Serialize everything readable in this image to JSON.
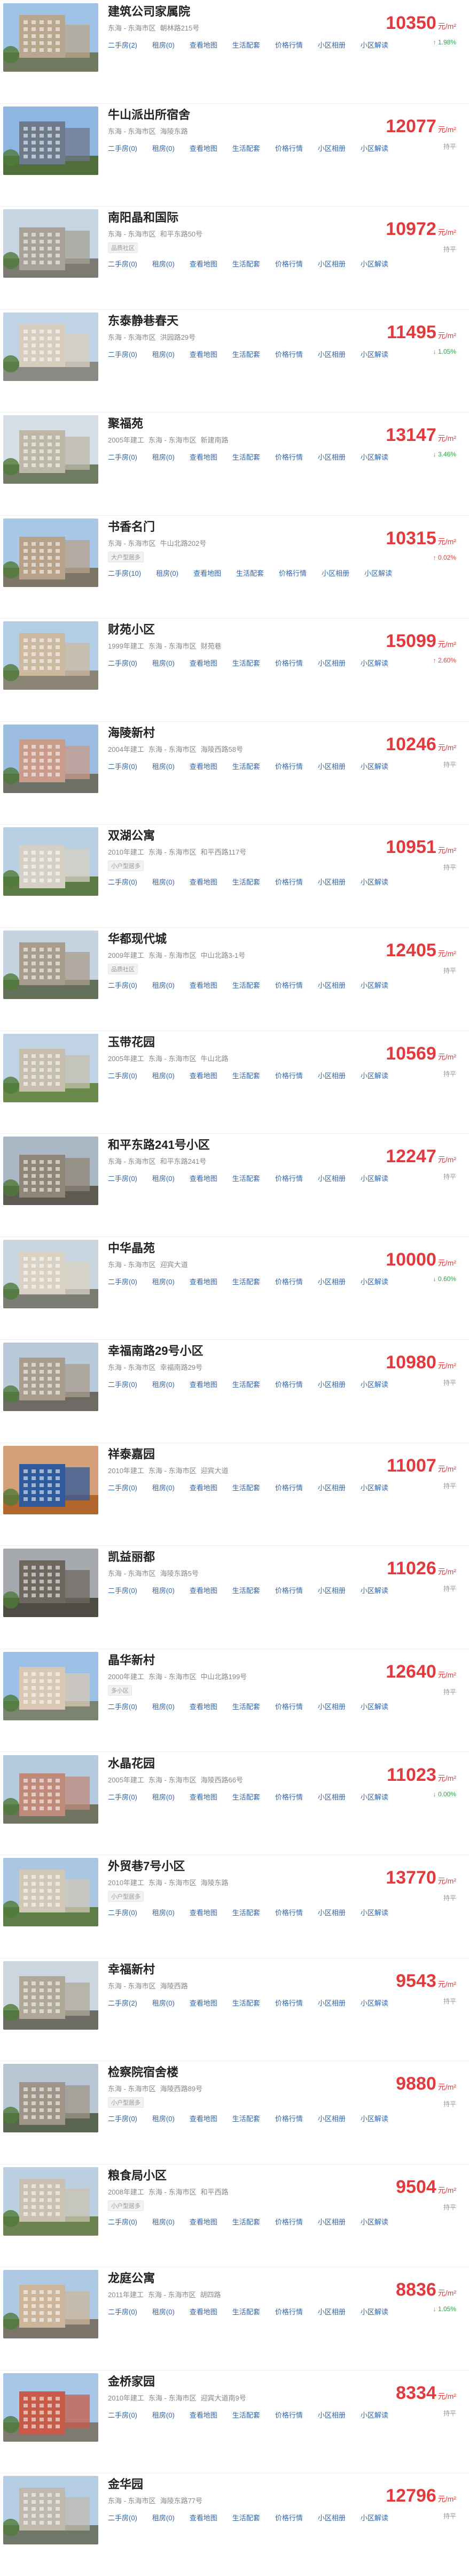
{
  "list": {
    "link_labels": [
      "二手房",
      "租房",
      "查看地图",
      "生活配套",
      "价格行情",
      "小区相册",
      "小区解读"
    ],
    "communities": [
      {
        "name": "建筑公司家属院",
        "meta": [
          "东海 - 东海市区",
          "朝林路215号"
        ],
        "tag": "",
        "counts": [
          2,
          0
        ],
        "price": "10350",
        "unit": "元/m²",
        "change": "↑ 1.98%",
        "trend": "down",
        "colors": {
          "sky": "#9fc3e6",
          "building": "#b8a78e",
          "ground": "#6f7a60"
        }
      },
      {
        "name": "牛山派出所宿舍",
        "meta": [
          "东海 - 东海市区",
          "海陵东路"
        ],
        "tag": "",
        "counts": [
          0,
          0
        ],
        "price": "12077",
        "unit": "元/m²",
        "change": "持平",
        "trend": "flat",
        "colors": {
          "sky": "#8fb6e0",
          "building": "#6d7a8c",
          "ground": "#4f6e3a"
        }
      },
      {
        "name": "南阳晶和国际",
        "meta": [
          "东海 - 东海市区",
          "和平东路50号"
        ],
        "tag": "品质社区",
        "counts": [
          0,
          0
        ],
        "price": "10972",
        "unit": "元/m²",
        "change": "持平",
        "trend": "flat",
        "colors": {
          "sky": "#c7d5e2",
          "building": "#a7a197",
          "ground": "#7c7a72"
        }
      },
      {
        "name": "东泰静巷春天",
        "meta": [
          "东海 - 东海市区",
          "洪园路29号"
        ],
        "tag": "",
        "counts": [
          0,
          0
        ],
        "price": "11495",
        "unit": "元/m²",
        "change": "↓ 1.05%",
        "trend": "down",
        "colors": {
          "sky": "#bfd2e6",
          "building": "#d8cdbd",
          "ground": "#8a8a84"
        }
      },
      {
        "name": "聚福苑",
        "meta": [
          "2005年建工",
          "东海 - 东海市区",
          "新建南路"
        ],
        "tag": "",
        "counts": [
          0,
          0
        ],
        "price": "13147",
        "unit": "元/m²",
        "change": "↓ 3.46%",
        "trend": "down",
        "colors": {
          "sky": "#d6dfe8",
          "building": "#bdb7a8",
          "ground": "#6f7c62"
        }
      },
      {
        "name": "书香名门",
        "meta": [
          "东海 - 东海市区",
          "牛山北路202号"
        ],
        "tag": "大户型居多",
        "counts": [
          10,
          0
        ],
        "price": "10315",
        "unit": "元/m²",
        "change": "↑ 0.02%",
        "trend": "up",
        "colors": {
          "sky": "#a9c8e8",
          "building": "#b7a289",
          "ground": "#7d7566"
        }
      },
      {
        "name": "财苑小区",
        "meta": [
          "1999年建工",
          "东海 - 东海市区",
          "财苑巷"
        ],
        "tag": "",
        "counts": [
          0,
          0
        ],
        "price": "15099",
        "unit": "元/m²",
        "change": "↑ 2.60%",
        "trend": "up",
        "colors": {
          "sky": "#b3cde6",
          "building": "#cbb9a0",
          "ground": "#8b8576"
        }
      },
      {
        "name": "海陵新村",
        "meta": [
          "2004年建工",
          "东海 - 东海市区",
          "海陵西路58号"
        ],
        "tag": "",
        "counts": [
          0,
          0
        ],
        "price": "10246",
        "unit": "元/m²",
        "change": "持平",
        "trend": "flat",
        "colors": {
          "sky": "#9dbde0",
          "building": "#c89b8a",
          "ground": "#6e7166"
        }
      },
      {
        "name": "双湖公寓",
        "meta": [
          "2010年建工",
          "东海 - 东海市区",
          "和平西路117号"
        ],
        "tag": "小户型居多",
        "counts": [
          0,
          0
        ],
        "price": "10951",
        "unit": "元/m²",
        "change": "持平",
        "trend": "flat",
        "colors": {
          "sky": "#b9d0e4",
          "building": "#d5d0c4",
          "ground": "#5c7a44"
        }
      },
      {
        "name": "华都现代城",
        "meta": [
          "2009年建工",
          "东海 - 东海市区",
          "中山北路3-1号"
        ],
        "tag": "品质社区",
        "counts": [
          0,
          0
        ],
        "price": "12405",
        "unit": "元/m²",
        "change": "持平",
        "trend": "flat",
        "colors": {
          "sky": "#c5d4e0",
          "building": "#a89c8c",
          "ground": "#63705a"
        }
      },
      {
        "name": "玉带花园",
        "meta": [
          "2005年建工",
          "东海 - 东海市区",
          "牛山北路"
        ],
        "tag": "",
        "counts": [
          0,
          0
        ],
        "price": "10569",
        "unit": "元/m²",
        "change": "持平",
        "trend": "flat",
        "colors": {
          "sky": "#c0d3e5",
          "building": "#c6bfae",
          "ground": "#6a8a4c"
        }
      },
      {
        "name": "和平东路241号小区",
        "meta": [
          "东海 - 东海市区",
          "和平东路241号"
        ],
        "tag": "",
        "counts": [
          0,
          0
        ],
        "price": "12247",
        "unit": "元/m²",
        "change": "持平",
        "trend": "flat",
        "colors": {
          "sky": "#aab7c4",
          "building": "#8f8677",
          "ground": "#5d5a52"
        }
      },
      {
        "name": "中华晶苑",
        "meta": [
          "东海 - 东海市区",
          "迎宾大道"
        ],
        "tag": "",
        "counts": [
          0,
          0
        ],
        "price": "10000",
        "unit": "元/m²",
        "change": "↓ 0.60%",
        "trend": "down",
        "colors": {
          "sky": "#c9d5df",
          "building": "#d9d2c4",
          "ground": "#7b7d74"
        }
      },
      {
        "name": "幸福南路29号小区",
        "meta": [
          "东海 - 东海市区",
          "幸福南路29号"
        ],
        "tag": "",
        "counts": [
          0,
          0
        ],
        "price": "10980",
        "unit": "元/m²",
        "change": "持平",
        "trend": "flat",
        "colors": {
          "sky": "#b9cadb",
          "building": "#a99e8e",
          "ground": "#6d6b63"
        }
      },
      {
        "name": "祥泰嘉园",
        "meta": [
          "2010年建工",
          "东海 - 东海市区",
          "迎宾大道"
        ],
        "tag": "",
        "counts": [
          0,
          0
        ],
        "price": "11007",
        "unit": "元/m²",
        "change": "持平",
        "trend": "flat",
        "colors": {
          "sky": "#d3a07a",
          "building": "#2f5a9c",
          "ground": "#b2662e"
        }
      },
      {
        "name": "凯益丽都",
        "meta": [
          "东海 - 东海市区",
          "海陵东路5号"
        ],
        "tag": "",
        "counts": [
          0,
          0
        ],
        "price": "11026",
        "unit": "元/m²",
        "change": "持平",
        "trend": "flat",
        "colors": {
          "sky": "#a6a9ad",
          "building": "#6e6760",
          "ground": "#4e4b45"
        }
      },
      {
        "name": "晶华新村",
        "meta": [
          "2000年建工",
          "东海 - 东海市区",
          "中山北路199号"
        ],
        "tag": "多小区",
        "counts": [
          0,
          0
        ],
        "price": "12640",
        "unit": "元/m²",
        "change": "持平",
        "trend": "flat",
        "colors": {
          "sky": "#9cc0e6",
          "building": "#d9c8b4",
          "ground": "#7b8470"
        }
      },
      {
        "name": "水晶花园",
        "meta": [
          "2005年建工",
          "东海 - 东海市区",
          "海陵西路66号"
        ],
        "tag": "",
        "counts": [
          0,
          0
        ],
        "price": "11023",
        "unit": "元/m²",
        "change": "↓ 0.00%",
        "trend": "down",
        "colors": {
          "sky": "#b4cbe0",
          "building": "#c08a7a",
          "ground": "#6f735f"
        }
      },
      {
        "name": "外贸巷7号小区",
        "meta": [
          "2010年建工",
          "东海 - 东海市区",
          "海陵东路"
        ],
        "tag": "小户型居多",
        "counts": [
          0,
          0
        ],
        "price": "13770",
        "unit": "元/m²",
        "change": "持平",
        "trend": "flat",
        "colors": {
          "sky": "#aac6e2",
          "building": "#d2c8b8",
          "ground": "#5f7d46"
        }
      },
      {
        "name": "幸福新村",
        "meta": [
          "东海 - 东海市区",
          "海陵西路"
        ],
        "tag": "",
        "counts": [
          2,
          0
        ],
        "price": "9543",
        "unit": "元/m²",
        "change": "持平",
        "trend": "flat",
        "colors": {
          "sky": "#cbd6df",
          "building": "#b0a897",
          "ground": "#6e6d65"
        }
      },
      {
        "name": "检察院宿舍楼",
        "meta": [
          "东海 - 东海市区",
          "海陵西路89号"
        ],
        "tag": "小户型居多",
        "counts": [
          0,
          0
        ],
        "price": "9880",
        "unit": "元/m²",
        "change": "持平",
        "trend": "flat",
        "colors": {
          "sky": "#b8c7d3",
          "building": "#9e9588",
          "ground": "#5a6550"
        }
      },
      {
        "name": "粮食局小区",
        "meta": [
          "2008年建工",
          "东海 - 东海市区",
          "和平西路"
        ],
        "tag": "小户型居多",
        "counts": [
          0,
          0
        ],
        "price": "9504",
        "unit": "元/m²",
        "change": "持平",
        "trend": "flat",
        "colors": {
          "sky": "#bcd0e2",
          "building": "#c9c1b2",
          "ground": "#6d8350"
        }
      },
      {
        "name": "龙庭公寓",
        "meta": [
          "2011年建工",
          "东海 - 东海市区",
          "胡四路"
        ],
        "tag": "",
        "counts": [
          0,
          0
        ],
        "price": "8836",
        "unit": "元/m²",
        "change": "↓ 1.05%",
        "trend": "down",
        "colors": {
          "sky": "#aec9e4",
          "building": "#ccb59a",
          "ground": "#7a7568"
        }
      },
      {
        "name": "金桥家园",
        "meta": [
          "2010年建工",
          "东海 - 东海市区",
          "迎宾大道南9号"
        ],
        "tag": "",
        "counts": [
          0,
          0
        ],
        "price": "8334",
        "unit": "元/m²",
        "change": "持平",
        "trend": "flat",
        "colors": {
          "sky": "#a7c6e8",
          "building": "#c75b4a",
          "ground": "#7f7a70"
        }
      },
      {
        "name": "金华园",
        "meta": [
          "东海 - 东海市区",
          "海陵东路77号"
        ],
        "tag": "",
        "counts": [
          0,
          0
        ],
        "price": "12796",
        "unit": "元/m²",
        "change": "持平",
        "trend": "flat",
        "colors": {
          "sky": "#b5cde3",
          "building": "#bfb9ad",
          "ground": "#6f7769"
        }
      }
    ]
  }
}
